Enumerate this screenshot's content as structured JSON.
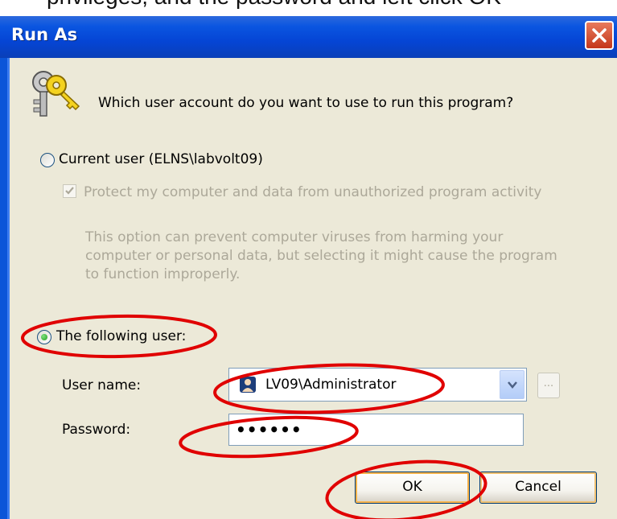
{
  "caption": "privileges, and the password and left click OK",
  "window": {
    "title": "Run As"
  },
  "prompt": "Which user account do you want to use to run this program?",
  "current_user": {
    "label": "Current user (ELNS\\labvolt09)",
    "selected": false,
    "protect_checkbox": {
      "label": "Protect my computer and data from unauthorized program activity",
      "checked": true,
      "enabled": false
    },
    "description_lines": [
      "This option can prevent computer viruses from harming your",
      "computer or personal data, but selecting it might cause the program",
      "to function improperly."
    ]
  },
  "following_user": {
    "label": "The following user:",
    "selected": true,
    "user_name_label": "User name:",
    "user_name_value": "LV09\\Administrator",
    "browse_label": "...",
    "password_label": "Password:",
    "password_value": "••••••"
  },
  "buttons": {
    "ok": "OK",
    "cancel": "Cancel"
  },
  "icons": {
    "keys": "keys-icon",
    "close": "close-icon",
    "user": "user-icon",
    "dropdown": "chevron-down-icon"
  },
  "colors": {
    "titlebar": "#0545d5",
    "dialog_bg": "#ece9d8",
    "close": "#c4371b",
    "annotation": "#e00000",
    "disabled_text": "#aca899"
  }
}
